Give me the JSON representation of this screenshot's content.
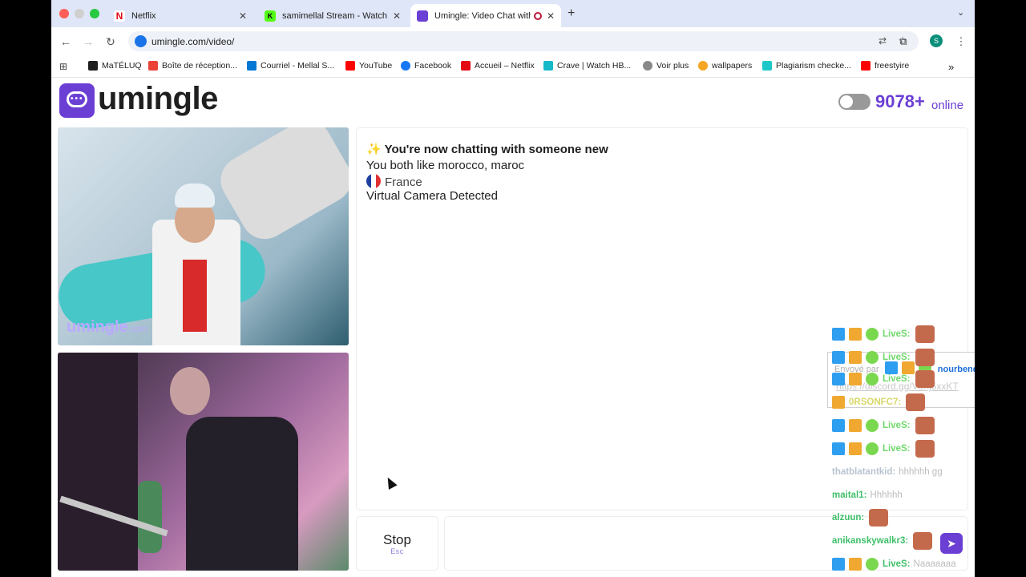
{
  "tabs": [
    {
      "title": "Netflix",
      "favicon_color": "#e50914",
      "favicon_letter": "N"
    },
    {
      "title": "samimellal Stream - Watch Li",
      "favicon_color": "#53fc18",
      "favicon_letter": "K"
    },
    {
      "title": "Umingle: Video Chat with",
      "favicon_color": "#6c3fd4",
      "favicon_letter": ""
    }
  ],
  "address_bar": {
    "url": "umingle.com/video/"
  },
  "profile_initial": "S",
  "bookmarks": [
    {
      "label": "MaTÉLUQ",
      "color": "#1f1f1f"
    },
    {
      "label": "Boîte de réception...",
      "color": "#ea4335"
    },
    {
      "label": "Courriel - Mellal S...",
      "color": "#0078d4"
    },
    {
      "label": "YouTube",
      "color": "#ff0000"
    },
    {
      "label": "Facebook",
      "color": "#1877f2"
    },
    {
      "label": "Accueil – Netflix",
      "color": "#e50914"
    },
    {
      "label": "Crave | Watch HB...",
      "color": "#17b8c8"
    },
    {
      "label": "Voir plus",
      "color": "#555555"
    },
    {
      "label": "wallpapers",
      "color": "#f5a623"
    },
    {
      "label": "Plagiarism checke...",
      "color": "#1ec8c8"
    },
    {
      "label": "freestyire",
      "color": "#ff0000"
    }
  ],
  "header": {
    "logo_text": "umingle",
    "online_count": "9078+",
    "online_label": "online",
    "accent": "#6c3fd4"
  },
  "remote_video": {
    "watermark": "umingle",
    "watermark_suffix": ".com"
  },
  "chat": {
    "headline_icon": "✨",
    "headline": "You're now chatting with someone new",
    "shared_interests": "You both like morocco, maroc",
    "country": "France",
    "notice": "Virtual Camera Detected"
  },
  "controls": {
    "stop_label": "Stop",
    "stop_key": "Esc",
    "message_placeholder": ""
  },
  "stream_overlay": {
    "top_prefix": "Envoyé par",
    "top_user": "nourbendaoud",
    "top_link": "https://discord.gg/V8nj5xxKT",
    "rows": [
      {
        "name": "LiveS:",
        "badges": [
          "blue",
          "gold",
          "green"
        ],
        "emote": true,
        "msg": ""
      },
      {
        "name": "LiveS:",
        "badges": [
          "blue",
          "gold",
          "green"
        ],
        "emote": true,
        "msg": ""
      },
      {
        "name": "LiveS:",
        "badges": [
          "blue",
          "gold",
          "green"
        ],
        "emote": true,
        "msg": ""
      },
      {
        "name": "0RSONFC7:",
        "badges": [
          "gold"
        ],
        "emote": true,
        "msg": ""
      },
      {
        "name": "LiveS:",
        "badges": [
          "blue",
          "gold",
          "green"
        ],
        "emote": true,
        "msg": ""
      },
      {
        "name": "LiveS:",
        "badges": [
          "blue",
          "gold",
          "green"
        ],
        "emote": true,
        "msg": ""
      },
      {
        "name": "thatblatantkid:",
        "badges": [],
        "emote": false,
        "msg": "hhhhhh gg"
      },
      {
        "name": "maital1:",
        "badges": [],
        "emote": false,
        "msg": "Hhhhhh"
      },
      {
        "name": "alzuun:",
        "badges": [],
        "emote": true,
        "msg": ""
      },
      {
        "name": "anikanskywalkr3:",
        "badges": [],
        "emote": true,
        "msg": ""
      },
      {
        "name": "LiveS:",
        "badges": [
          "blue",
          "gold",
          "green"
        ],
        "emote": false,
        "msg": "Naaaaaaa"
      }
    ]
  }
}
